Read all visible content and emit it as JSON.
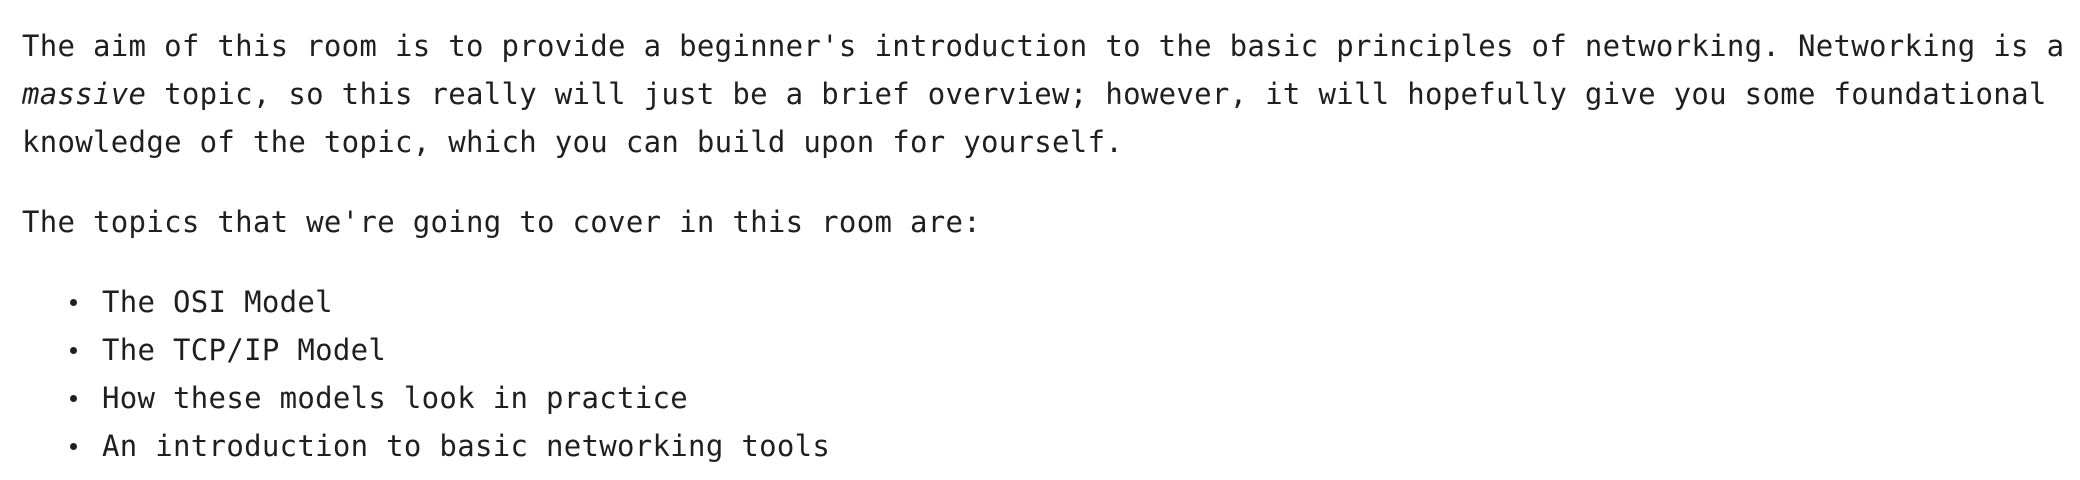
{
  "intro": {
    "part1": "The aim of this room is to provide a beginner's introduction to the basic principles of networking. Networking is a ",
    "emphasis": "massive",
    "part2": " topic, so this really will just be a brief overview; however, it will hopefully give you some foundational knowledge of the topic, which you can build upon for yourself."
  },
  "topics_intro": "The topics that we're going to cover in this room are:",
  "topics": [
    "The OSI Model",
    "The TCP/IP Model",
    "How these models look in practice",
    "An introduction to basic networking tools"
  ]
}
